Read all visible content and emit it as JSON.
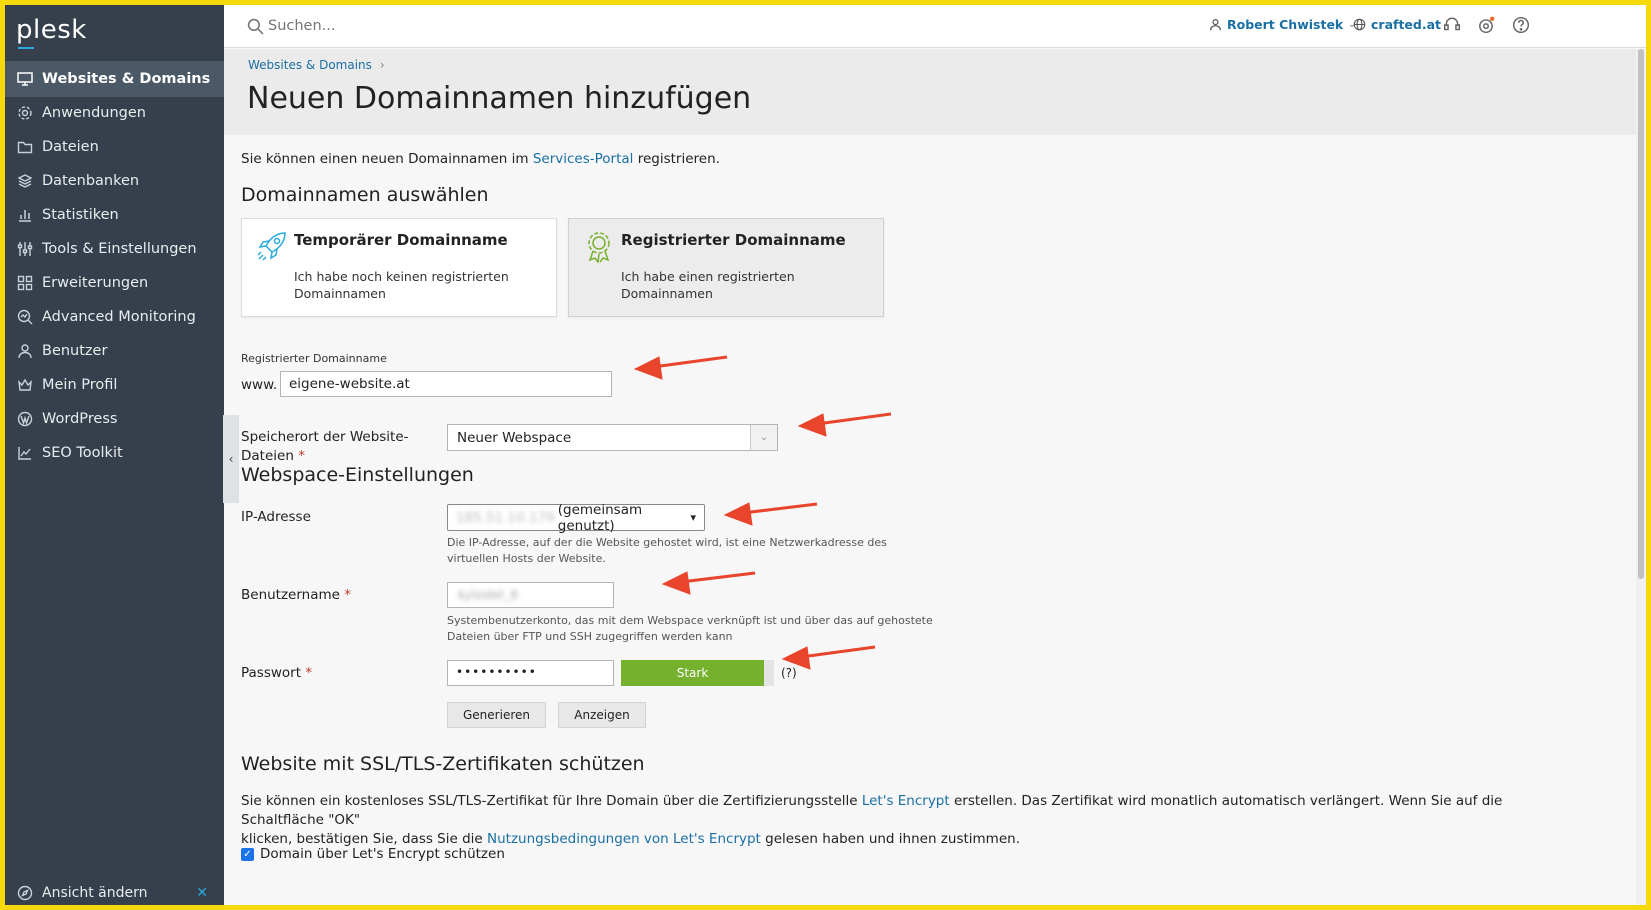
{
  "app": {
    "logo": "plesk"
  },
  "sidebar": {
    "items": [
      {
        "label": "Websites & Domains",
        "icon": "monitor-icon",
        "active": true
      },
      {
        "label": "Anwendungen",
        "icon": "gear-icon"
      },
      {
        "label": "Dateien",
        "icon": "folder-icon"
      },
      {
        "label": "Datenbanken",
        "icon": "layers-icon"
      },
      {
        "label": "Statistiken",
        "icon": "bar-chart-icon"
      },
      {
        "label": "Tools & Einstellungen",
        "icon": "sliders-icon"
      },
      {
        "label": "Erweiterungen",
        "icon": "grid-icon"
      },
      {
        "label": "Advanced Monitoring",
        "icon": "monitoring-icon"
      },
      {
        "label": "Benutzer",
        "icon": "user-icon"
      },
      {
        "label": "Mein Profil",
        "icon": "crown-icon"
      },
      {
        "label": "WordPress",
        "icon": "wordpress-icon"
      },
      {
        "label": "SEO Toolkit",
        "icon": "chart-edit-icon"
      }
    ],
    "view_switch": "Ansicht ändern"
  },
  "topbar": {
    "search_placeholder": "Suchen...",
    "user": "Robert Chwistek",
    "domain": "crafted.at"
  },
  "breadcrumb": {
    "item": "Websites & Domains"
  },
  "page": {
    "title": "Neuen Domainnamen hinzufügen",
    "intro_before": "Sie können einen neuen Domainnamen im ",
    "intro_link": "Services-Portal",
    "intro_after": " registrieren."
  },
  "domain_select": {
    "heading": "Domainnamen auswählen",
    "cards": [
      {
        "title": "Temporärer Domainname",
        "desc": "Ich habe noch keinen registrierten Domainnamen",
        "selected": false
      },
      {
        "title": "Registrierter Domainname",
        "desc": "Ich habe einen registrierten Domainnamen",
        "selected": true
      }
    ]
  },
  "form": {
    "domain_label": "Registrierter Domainname",
    "www_prefix": "www.",
    "domain_value": "eigene-website.at",
    "location_label": "Speicherort der Website-Dateien",
    "location_value": "Neuer Webspace",
    "required_mark": "*"
  },
  "webspace": {
    "heading": "Webspace-Einstellungen",
    "ip_label": "IP-Adresse",
    "ip_value": "185.51.10.179",
    "ip_suffix": "(gemeinsam genutzt)",
    "ip_hint": "Die IP-Adresse, auf der die Website gehostet wird, ist eine Netzwerkadresse des virtuellen Hosts der Website.",
    "username_label": "Benutzername",
    "username_value": "kylsidet_8",
    "username_hint": "Systembenutzerkonto, das mit dem Webspace verknüpft ist und über das auf gehostete Dateien über FTP und SSH zugegriffen werden kann",
    "password_label": "Passwort",
    "password_value": "••••••••••",
    "strength": "Stark",
    "help": "(?)",
    "generate": "Generieren",
    "show": "Anzeigen"
  },
  "ssl": {
    "heading": "Website mit SSL/TLS-Zertifikaten schützen",
    "text_1": "Sie können ein kostenloses SSL/TLS-Zertifikat für Ihre Domain über die Zertifizierungsstelle ",
    "link_1": "Let's Encrypt",
    "text_2": " erstellen. Das Zertifikat wird monatlich automatisch verlängert. Wenn Sie auf die Schaltfläche \"OK\"",
    "text_3": "klicken, bestätigen Sie, dass Sie die ",
    "link_2": "Nutzungsbedingungen von Let's Encrypt",
    "text_4": " gelesen haben und ihnen zustimmen.",
    "checkbox_label": "Domain über Let's Encrypt schützen",
    "checkbox_checked": true
  },
  "colors": {
    "sidebar": "#35404c",
    "link": "#1a6fa3",
    "strength": "#76b12d",
    "arrow": "#e8452c",
    "frame": "#f5d90a"
  }
}
